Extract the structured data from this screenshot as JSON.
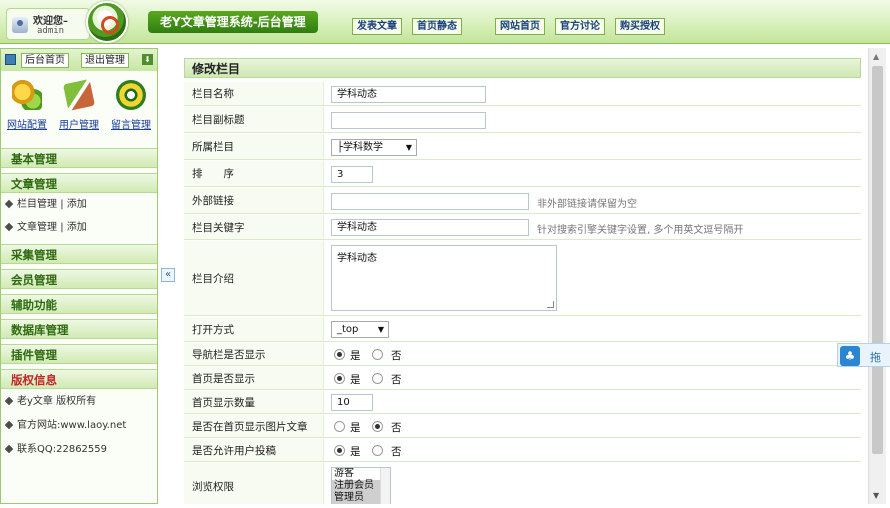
{
  "header": {
    "welcome": "欢迎您–",
    "username": "admin",
    "system_title": "老Y文章管理系统-后台管理",
    "nav": [
      "发表文章",
      "首页静态",
      "网站首页",
      "官方讨论",
      "购买授权"
    ]
  },
  "sidebar": {
    "top_buttons": [
      "后台首页",
      "退出管理"
    ],
    "quick_links": [
      "网站配置",
      "用户管理",
      "留言管理"
    ],
    "collapse_symbol": "«",
    "sections": {
      "basic": "基本管理",
      "article": "文章管理",
      "collect": "采集管理",
      "member": "会员管理",
      "assist": "辅助功能",
      "database": "数据库管理",
      "plugin": "插件管理",
      "copyright": "版权信息"
    },
    "article_items": [
      {
        "name": "栏目管理",
        "sep": "|",
        "add": "添加"
      },
      {
        "name": "文章管理",
        "sep": "|",
        "add": "添加"
      }
    ],
    "copyright_items": [
      "老y文章 版权所有",
      "官方网站:www.laoy.net",
      "联系QQ:22862559"
    ]
  },
  "form": {
    "title": "修改栏目",
    "labels": {
      "name": "栏目名称",
      "subtitle": "栏目副标题",
      "parent": "所属栏目",
      "order": "排　　序",
      "external": "外部链接",
      "keywords": "栏目关键字",
      "intro": "栏目介绍",
      "open_mode": "打开方式",
      "nav_show": "导航栏是否显示",
      "home_show": "首页是否显示",
      "home_count": "首页显示数量",
      "home_img": "是否在首页显示图片文章",
      "user_post": "是否允许用户投稿",
      "perm": "浏览权限"
    },
    "values": {
      "name": "学科动态",
      "subtitle": "",
      "parent": "├学科数学",
      "order": "3",
      "external": "",
      "keywords": "学科动态",
      "intro": "学科动态",
      "open_mode": "_top",
      "home_count": "10"
    },
    "hints": {
      "external": "非外部链接请保留为空",
      "keywords": "针对搜索引擎关键字设置, 多个用英文逗号隔开"
    },
    "radio_yes": "是",
    "radio_no": "否",
    "radios": {
      "nav_show": "yes",
      "home_show": "yes",
      "home_img": "no",
      "user_post": "yes"
    },
    "perm_options": [
      "游客",
      "注册会员",
      "管理员"
    ]
  },
  "floating_widget": {
    "label": "拖"
  }
}
